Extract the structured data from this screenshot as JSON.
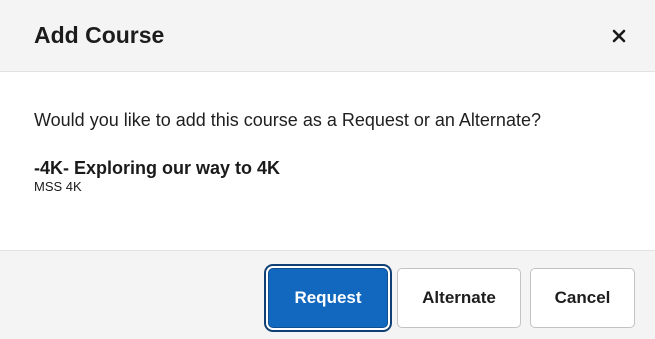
{
  "dialog": {
    "title": "Add Course",
    "close_icon": "close-icon",
    "prompt": "Would you like to add this course as a Request or an Alternate?",
    "course": {
      "title": "-4K- Exploring our way to 4K",
      "code": "MSS 4K"
    },
    "buttons": {
      "request": "Request",
      "alternate": "Alternate",
      "cancel": "Cancel"
    }
  },
  "colors": {
    "primary": "#1268bf",
    "header_bg": "#f4f4f4",
    "footer_bg": "#f4f4f4",
    "focus_ring": "#0f3f74"
  }
}
